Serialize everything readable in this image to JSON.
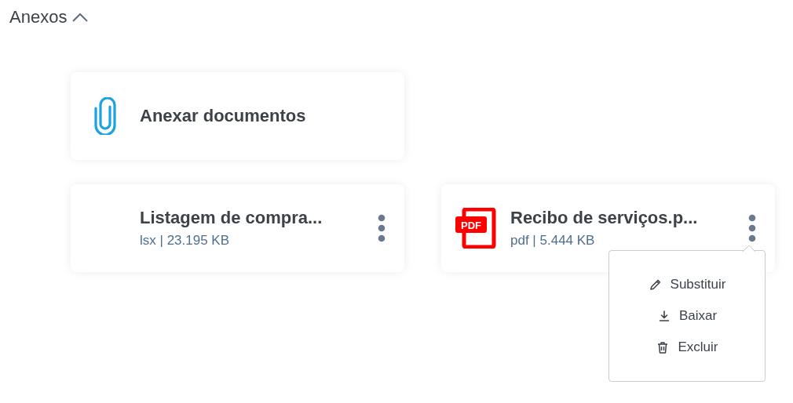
{
  "section": {
    "title": "Anexos",
    "expanded": true
  },
  "attach_button": {
    "label": "Anexar documentos"
  },
  "files": [
    {
      "name": "Listagem de compra...",
      "meta": "lsx | 23.195 KB",
      "kind": "none",
      "menu_open": false
    },
    {
      "name": "Recibo de serviços.p...",
      "meta": "pdf | 5.444 KB",
      "kind": "pdf",
      "icon_label": "PDF",
      "menu_open": true
    }
  ],
  "menu": [
    {
      "label": "Substituir",
      "kind": "edit"
    },
    {
      "label": "Baixar",
      "kind": "download"
    },
    {
      "label": "Excluir",
      "kind": "delete"
    }
  ]
}
